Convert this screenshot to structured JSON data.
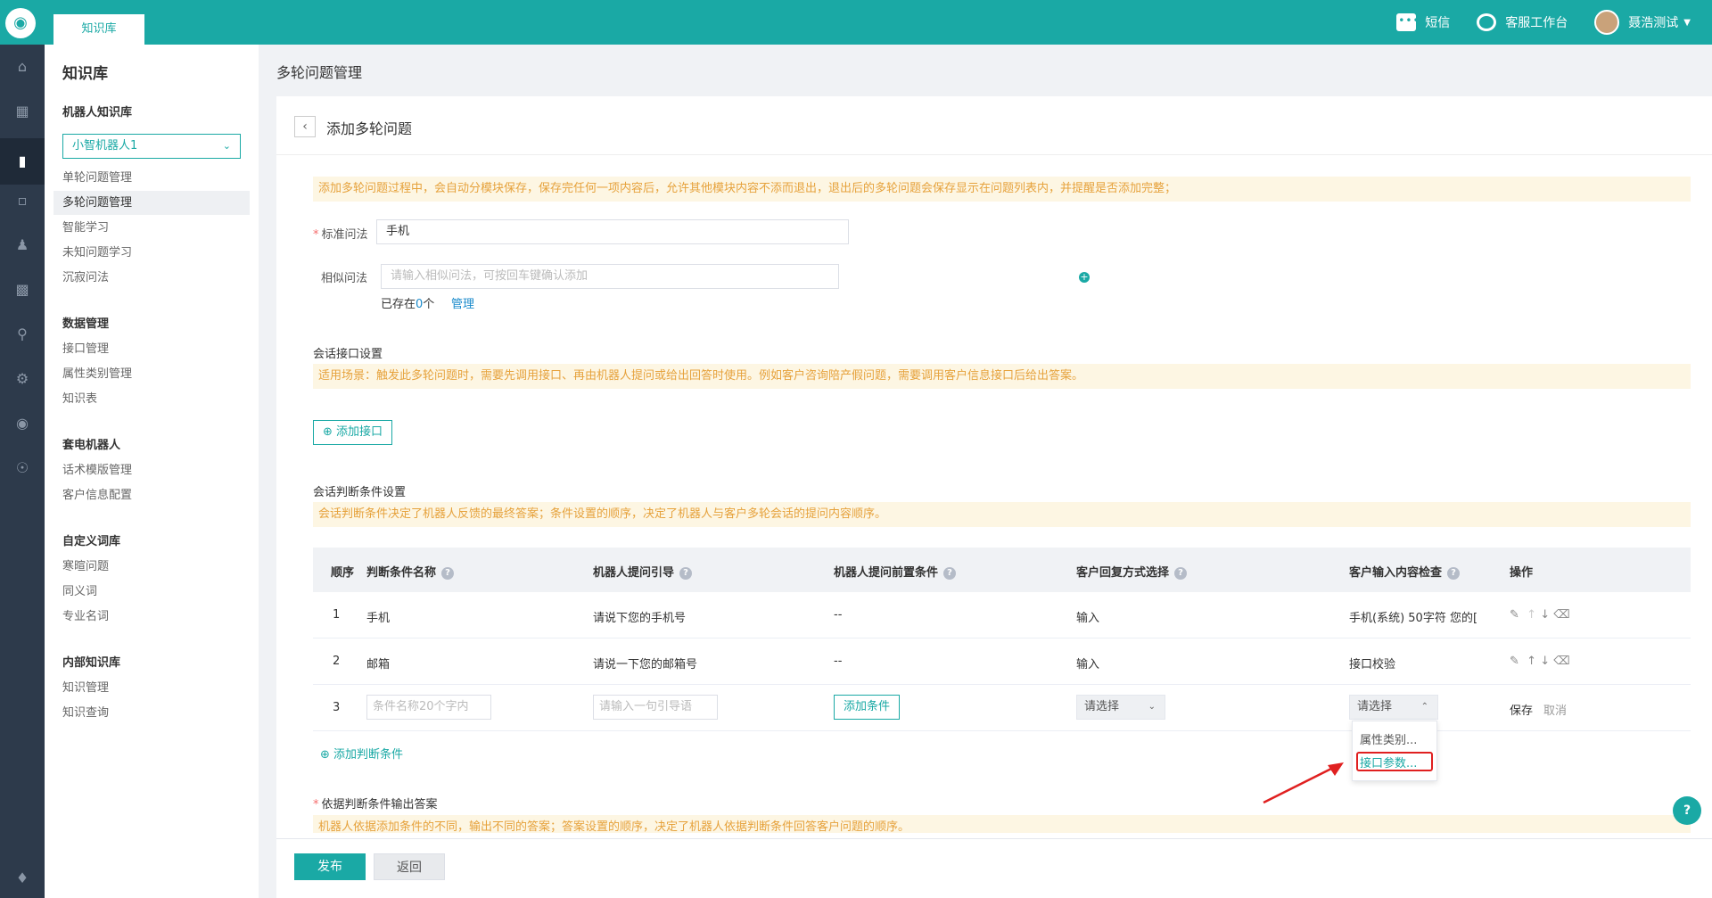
{
  "header": {
    "tab": "知识库",
    "sms": "短信",
    "workbench": "客服工作台",
    "user": "聂浩测试"
  },
  "sidebar": {
    "title": "知识库",
    "sections": [
      {
        "title": "机器人知识库",
        "items": [
          "单轮问题管理",
          "多轮问题管理",
          "智能学习",
          "未知问题学习",
          "沉寂问法"
        ]
      },
      {
        "title": "数据管理",
        "items": [
          "接口管理",
          "属性类别管理",
          "知识表"
        ]
      },
      {
        "title": "套电机器人",
        "items": [
          "话术模版管理",
          "客户信息配置"
        ]
      },
      {
        "title": "自定义词库",
        "items": [
          "寒暄问题",
          "同义词",
          "专业名词"
        ]
      },
      {
        "title": "内部知识库",
        "items": [
          "知识管理",
          "知识查询"
        ]
      }
    ],
    "robot_select": "小智机器人1",
    "active_item": "多轮问题管理"
  },
  "page": {
    "title": "多轮问题管理",
    "card_title": "添加多轮问题"
  },
  "form": {
    "notice": "添加多轮问题过程中，会自动分模块保存，保存完任何一项内容后，允许其他模块内容不添而退出，退出后的多轮问题会保存显示在问题列表内，并提醒是否添加完整；",
    "standard_label": "标准问法",
    "standard_value": "手机",
    "similar_label": "相似问法",
    "similar_placeholder": "请输入相似问法，可按回车键确认添加",
    "exist_prefix": "已存在",
    "exist_count": "0",
    "exist_suffix": "个",
    "manage": "管理"
  },
  "interface": {
    "title": "会话接口设置",
    "notice": "适用场景：触发此多轮问题时，需要先调用接口、再由机器人提问或给出回答时使用。例如客户咨询陪产假问题，需要调用客户信息接口后给出答案。",
    "add_button": "添加接口"
  },
  "conditions": {
    "title": "会话判断条件设置",
    "notice": "会话判断条件决定了机器人反馈的最终答案；条件设置的顺序，决定了机器人与客户多轮会话的提问内容顺序。",
    "headers": [
      "顺序",
      "判断条件名称",
      "机器人提问引导",
      "机器人提问前置条件",
      "客户回复方式选择",
      "客户输入内容检查",
      "操作"
    ],
    "rows": [
      {
        "order": "1",
        "name": "手机",
        "guide": "请说下您的手机号",
        "pre": "--",
        "reply": "输入",
        "check": "手机(系统) 50字符 您的["
      },
      {
        "order": "2",
        "name": "邮箱",
        "guide": "请说一下您的邮箱号",
        "pre": "--",
        "reply": "输入",
        "check": "接口校验"
      }
    ],
    "new_row": {
      "order": "3",
      "name_placeholder": "条件名称20个字内",
      "guide_placeholder": "请输入一句引导语",
      "add_condition": "添加条件",
      "reply_select": "请选择",
      "check_select": "请选择",
      "save": "保存",
      "cancel": "取消"
    },
    "dropdown_options": [
      "属性类别...",
      "接口参数..."
    ],
    "add_condition_link": "添加判断条件"
  },
  "answer": {
    "title": "依据判断条件输出答案",
    "notice": "机器人依据添加条件的不同，输出不同的答案；答案设置的顺序，决定了机器人依据判断条件回答客户问题的顺序。"
  },
  "footer": {
    "publish": "发布",
    "back": "返回"
  },
  "colors": {
    "accent": "#1aa9a5",
    "warning_bg": "#fdf6e3",
    "warning_text": "#e6a23c",
    "sidebar_dark": "#2d3a4b"
  }
}
